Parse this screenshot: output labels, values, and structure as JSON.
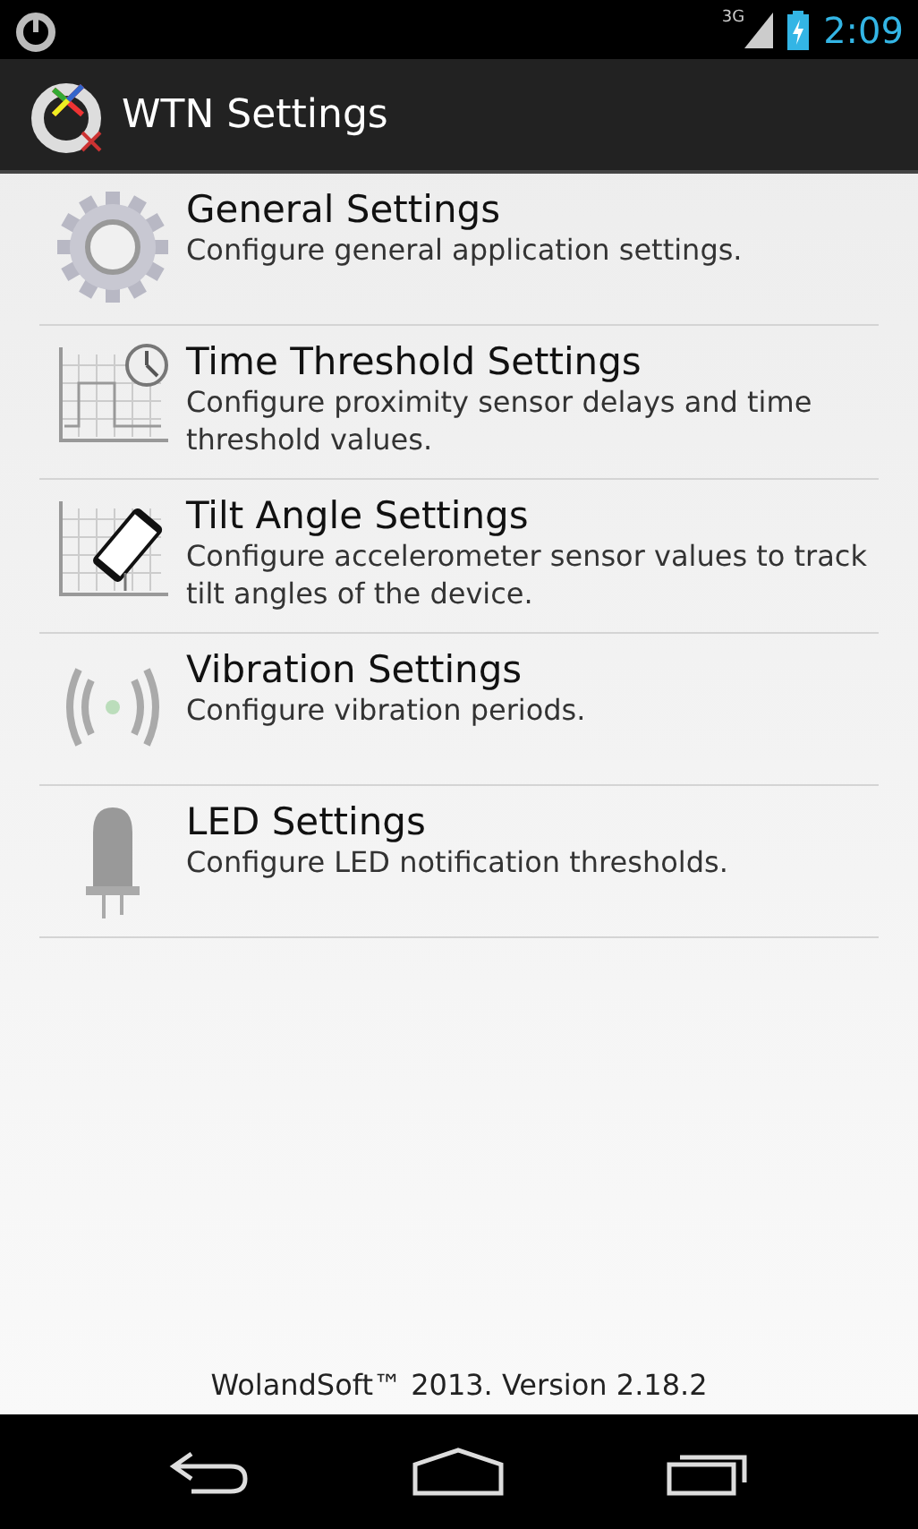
{
  "status_bar": {
    "network": "3G",
    "time": "2:09"
  },
  "action_bar": {
    "title": "WTN Settings"
  },
  "settings": [
    {
      "kind": "gear",
      "title": "General Settings",
      "summary": "Configure general application settings."
    },
    {
      "kind": "timer",
      "title": "Time Threshold Settings",
      "summary": "Configure proximity sensor delays and time threshold values."
    },
    {
      "kind": "tilt",
      "title": "Tilt Angle Settings",
      "summary": "Configure accelerometer sensor values to track tilt angles of the device."
    },
    {
      "kind": "vibration",
      "title": "Vibration Settings",
      "summary": "Configure vibration periods."
    },
    {
      "kind": "led",
      "title": "LED Settings",
      "summary": "Configure LED notification thresholds."
    }
  ],
  "footer": "WolandSoft™ 2013. Version 2.18.2"
}
